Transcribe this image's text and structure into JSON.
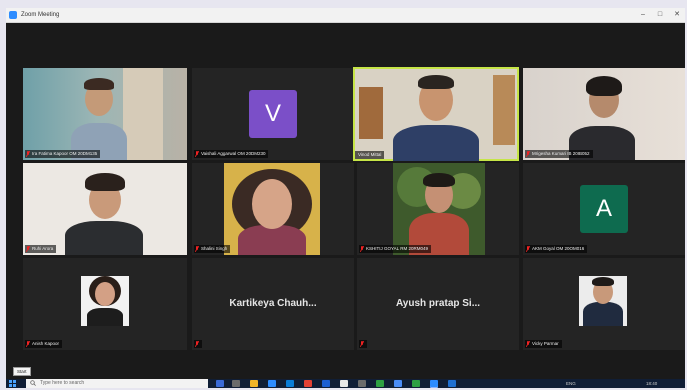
{
  "window": {
    "title": "Zoom Meeting",
    "controls": [
      "–",
      "□",
      "✕"
    ]
  },
  "participants": [
    {
      "name": "Ira Fatima Kapoor OM 20DM135",
      "muted": true,
      "kind": "video"
    },
    {
      "name": "Vaishali Aggarwal OM 20DM230",
      "muted": true,
      "kind": "avatar",
      "initial": "V",
      "color": "#7b4fc8"
    },
    {
      "name": "Vinod Mittal",
      "muted": false,
      "kind": "video",
      "active": true
    },
    {
      "name": "Mrigesha Kumari IB 20IB052",
      "muted": true,
      "kind": "video"
    },
    {
      "name": "Ruhi Arora",
      "muted": true,
      "kind": "video"
    },
    {
      "name": "Shalini Singh",
      "muted": true,
      "kind": "video"
    },
    {
      "name": "KSHITIJ GOYAL RM 20RM049",
      "muted": true,
      "kind": "video"
    },
    {
      "name": "AKM Goyal OM 20OM016",
      "muted": true,
      "kind": "avatar",
      "initial": "A",
      "color": "#0e6b4f"
    },
    {
      "name": "Anish Kapoor",
      "muted": true,
      "kind": "photo"
    },
    {
      "name": "",
      "muted": true,
      "kind": "text",
      "display": "Kartikeya Chauh..."
    },
    {
      "name": "",
      "muted": true,
      "kind": "text",
      "display": "Ayush pratap Si..."
    },
    {
      "name": "Vicky Parmar",
      "muted": true,
      "kind": "photo"
    }
  ],
  "taskbar": {
    "start_tooltip": "Start",
    "search_placeholder": "Type here to search",
    "app_colors": [
      "#3a6ad8",
      "#2d8cff",
      "#f0b429",
      "#0a7dd8",
      "#e44134",
      "#1d5fd1",
      "#6b6b6b",
      "#2ea043",
      "#4b8df8",
      "#2d8cff"
    ],
    "clock": "18:40",
    "date": "ENG"
  }
}
